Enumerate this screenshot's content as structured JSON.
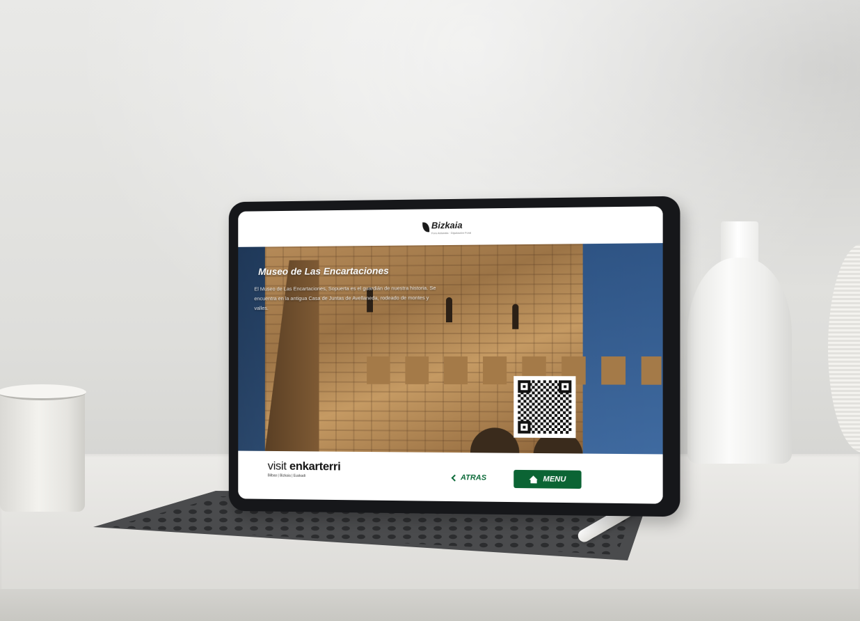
{
  "header": {
    "logo_text": "Bizkaia",
    "logo_subtext": "Foru Aldundia · Diputación Foral"
  },
  "hero": {
    "title": "Museo de Las Encartaciones",
    "description": "El Museo de Las Encartaciones, Sopuerta es el guardián de nuestra historia. Se encuentra en la antigua Casa de Juntas de Avellaneda, rodeado de montes y valles."
  },
  "footer": {
    "brand_light": "visit",
    "brand_bold": "enkarterri",
    "brand_sub": "Bilbao | Bizkaia | Euskadi",
    "back_label": "ATRAS",
    "menu_label": "MENU"
  },
  "colors": {
    "accent_green": "#0b6434",
    "header_bg": "#ffffff"
  },
  "icons": {
    "back": "chevron-left-icon",
    "menu": "home-icon",
    "qr": "qr-code-icon"
  }
}
